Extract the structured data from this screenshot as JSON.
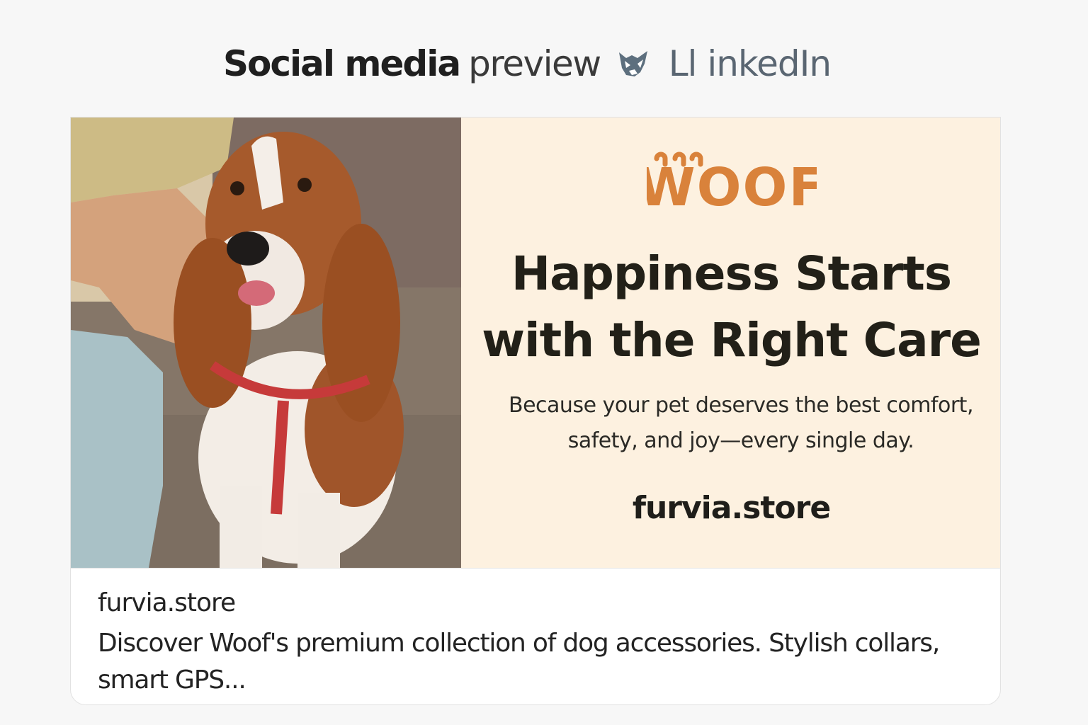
{
  "header": {
    "title_bold": "Social media",
    "title_light": "preview",
    "platform_icon": "cat-mascot-icon",
    "platform": "Ll inkedIn"
  },
  "banner": {
    "brand_logo": "WOOF",
    "headline_line1": "Happiness Starts",
    "headline_line2": "with the Right Care",
    "subtext_line1": "Because your pet deserves the best comfort,",
    "subtext_line2": "safety, and joy—every single day.",
    "url": "furvia.store",
    "photo_icon": "basset-hound-photo",
    "accent_color": "#d9823b",
    "background_color": "#fdf1e0"
  },
  "link_preview": {
    "domain": "furvia.store",
    "description_line1": "Discover Woof's premium collection of dog accessories. Stylish collars,",
    "description_line2": "smart GPS..."
  }
}
